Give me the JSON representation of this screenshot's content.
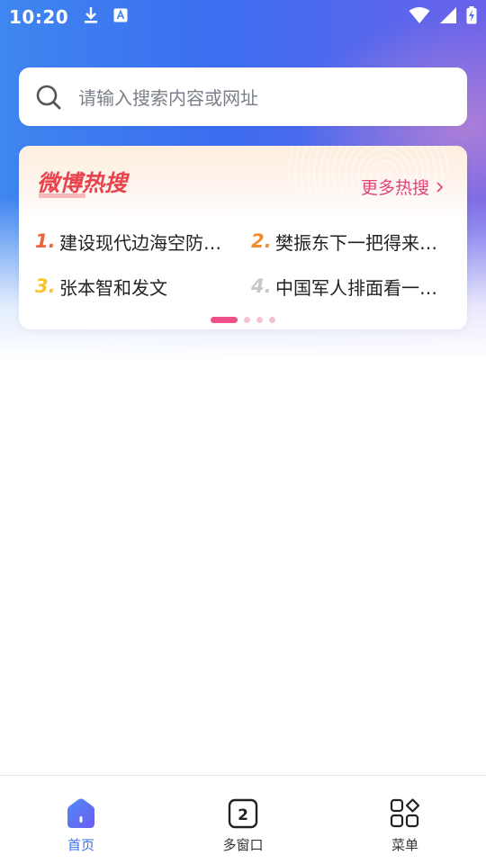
{
  "status_bar": {
    "time": "10:20",
    "left_icons": [
      "download-icon",
      "a-notification-icon"
    ],
    "right_icons": [
      "wifi-icon",
      "signal-icon",
      "battery-charging-icon"
    ]
  },
  "search": {
    "placeholder": "请输入搜索内容或网址"
  },
  "hot_card": {
    "logo_text": "微博热搜",
    "more_label": "更多热搜",
    "items": [
      {
        "rank": "1.",
        "text": "建设现代边海空防…",
        "color": "#f0643c"
      },
      {
        "rank": "2.",
        "text": "樊振东下一把得来…",
        "color": "#f28a2e"
      },
      {
        "rank": "3.",
        "text": "张本智和发文",
        "color": "#f5c52a"
      },
      {
        "rank": "4.",
        "text": "中国军人排面看一…",
        "color": "#c7c7c7"
      }
    ],
    "page_count": 4,
    "active_page": 1
  },
  "bottom_nav": {
    "items": [
      {
        "label": "首页",
        "icon": "home-icon",
        "active": true
      },
      {
        "label": "多窗口",
        "icon": "windows-icon",
        "badge": "2",
        "active": false
      },
      {
        "label": "菜单",
        "icon": "menu-grid-icon",
        "active": false
      }
    ]
  },
  "colors": {
    "accent_blue": "#3a6ff2",
    "weibo_pink": "#e0457a"
  }
}
